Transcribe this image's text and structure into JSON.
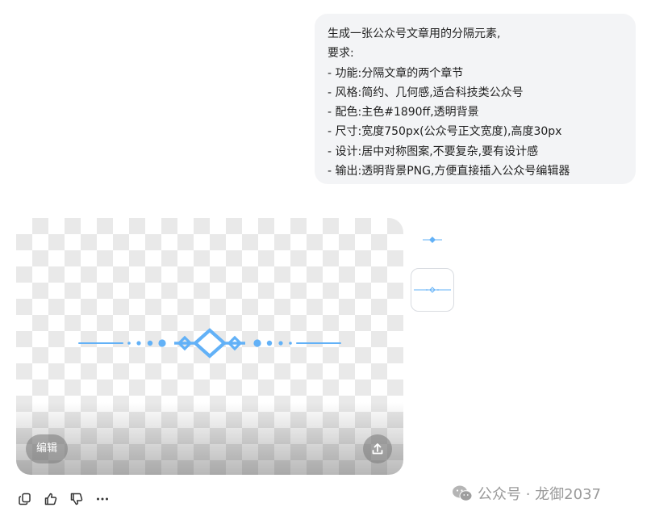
{
  "message": {
    "lines": [
      "生成一张公众号文章用的分隔元素,",
      "要求:",
      "- 功能:分隔文章的两个章节",
      "- 风格:简约、几何感,适合科技类公众号",
      "- 配色:主色#1890ff,透明背景",
      "- 尺寸:宽度750px(公众号正文宽度),高度30px",
      "- 设计:居中对称图案,不要复杂,要有设计感",
      "- 输出:透明背景PNG,方便直接插入公众号编辑器"
    ]
  },
  "image_card": {
    "edit_label": "编辑",
    "share_icon": "share-upload-icon",
    "divider_color": "#62b1f7"
  },
  "toolbar": {
    "icons": [
      "copy-icon",
      "thumbs-up-icon",
      "thumbs-down-icon",
      "more-icon"
    ]
  },
  "watermark": {
    "text": "公众号 · 龙御2037",
    "icon": "wechat-logo-icon"
  },
  "colors": {
    "bubble_bg": "#f3f4f6",
    "accent": "#62b1f7"
  }
}
